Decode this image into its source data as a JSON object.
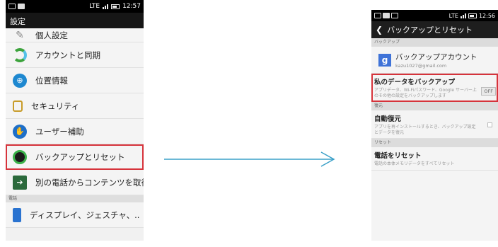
{
  "left_phone": {
    "status_time": "12:57",
    "status_network": "LTE",
    "title": "設定",
    "items": [
      {
        "label": "個人設定",
        "icon": "personal-settings-icon"
      },
      {
        "label": "アカウントと同期",
        "icon": "sync-icon"
      },
      {
        "label": "位置情報",
        "icon": "location-icon"
      },
      {
        "label": "セキュリティ",
        "icon": "lock-icon"
      },
      {
        "label": "ユーザー補助",
        "icon": "accessibility-icon"
      },
      {
        "label": "バックアップとリセット",
        "icon": "backup-icon"
      },
      {
        "label": "別の電話からコンテンツを取得",
        "icon": "transfer-icon"
      }
    ],
    "section_label": "電話",
    "display_item": {
      "label": "ディスプレイ、ジェスチャ、..",
      "icon": "display-icon"
    }
  },
  "right_phone": {
    "status_time": "12:56",
    "status_network": "LTE",
    "title": "バックアップとリセット",
    "backup_section": "バックアップ",
    "account_title": "バックアップアカウント",
    "account_email": "kazu1027@gmail.com",
    "backup_data_title": "私のデータをバックアップ",
    "backup_data_desc": "アプリデータ、Wi-Fiパスワード、Google サーバー上のその他の設定をバックアップします",
    "backup_toggle": "OFF",
    "restore_section": "復元",
    "auto_restore_title": "自動復元",
    "auto_restore_desc": "アプリを再インストールするとき、バックアップ設定とデータを復元",
    "reset_section": "リセット",
    "reset_title": "電話をリセット",
    "reset_desc": "電話の本体メモリデータをすべてリセット"
  },
  "colors": {
    "highlight": "#d6333b",
    "arrow": "#3aa0c8"
  }
}
